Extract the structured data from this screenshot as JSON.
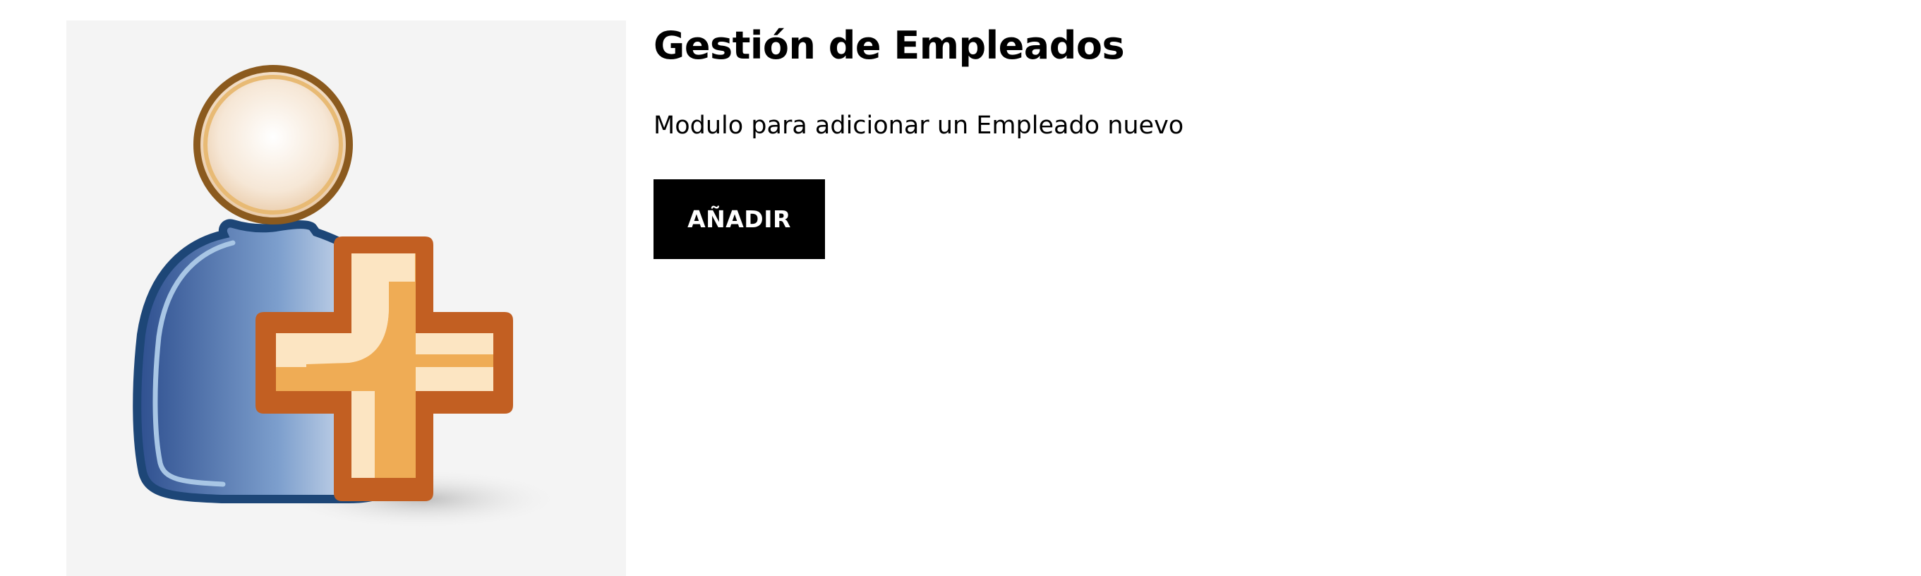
{
  "module": {
    "title": "Gestión de Empleados",
    "description": "Modulo para adicionar un Empleado nuevo",
    "add_button_label": "AÑADIR",
    "image_icon": "add-user-icon"
  },
  "colors": {
    "panel_background": "#f4f4f4",
    "button_background": "#000000",
    "button_text": "#ffffff",
    "person_body": "#4f72a8",
    "person_head_outline": "#8b5a1e",
    "plus_outline": "#c25f22",
    "plus_fill": "#efac55"
  }
}
